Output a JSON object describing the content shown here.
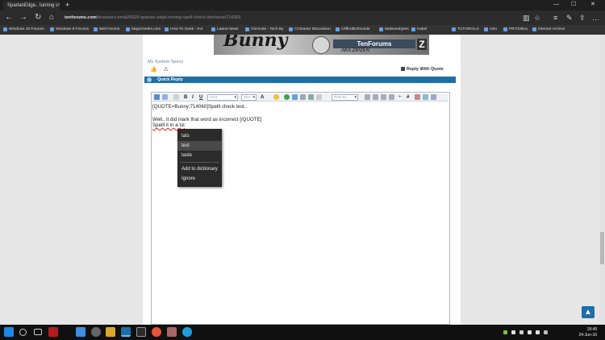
{
  "browser": {
    "tab_title": "SpartanEdge.. turning s",
    "tab_close": "×",
    "new_tab": "+",
    "win_min": "—",
    "win_max": "☐",
    "win_close": "✕",
    "address_domain": "tenforums.com",
    "address_path": "/browsers-email/6929-spartan-edge-turning-spell-check.html#post714383",
    "favorites": [
      "Windows 10 Forums",
      "Windows 8 Forums",
      "Mal Forums",
      "MajorGeeks.com",
      "How-To Geek - For",
      "Latest News",
      "Gizmodo - Tech By",
      "CCleaner Discussion",
      "CliffordEdmonds",
      "Malwarebytes",
      "Kabel",
      "TUTORIALS",
      "msn",
      "FRITZ!Box",
      "Internet Archive"
    ]
  },
  "page": {
    "sig_text": "Bunny",
    "sig_logo": "TenForums",
    "sig_sub": "AKA ZIPZEN",
    "sig_z": "Z",
    "system_specs": "My System Specs",
    "reply_with_quote": "Reply With Quote",
    "quick_reply": "Quick Reply",
    "back_to_top": "▲"
  },
  "editor": {
    "font_placeholder": "Font",
    "size_placeholder": "Size",
    "post_template_placeholder": "Post Te...",
    "lines": [
      "[QUOTE=Bunny;714060]Spelll check test..",
      "",
      "Well.. it did mark that word as incorrect [/QUOTE]",
      "Spelll it in a tst"
    ]
  },
  "context_menu": {
    "items": [
      "tats",
      "test",
      "taste",
      "Add to dictionary",
      "Ignore"
    ],
    "highlighted": "test"
  },
  "taskbar": {
    "time": "18:48",
    "date": "24-Jun-16"
  }
}
